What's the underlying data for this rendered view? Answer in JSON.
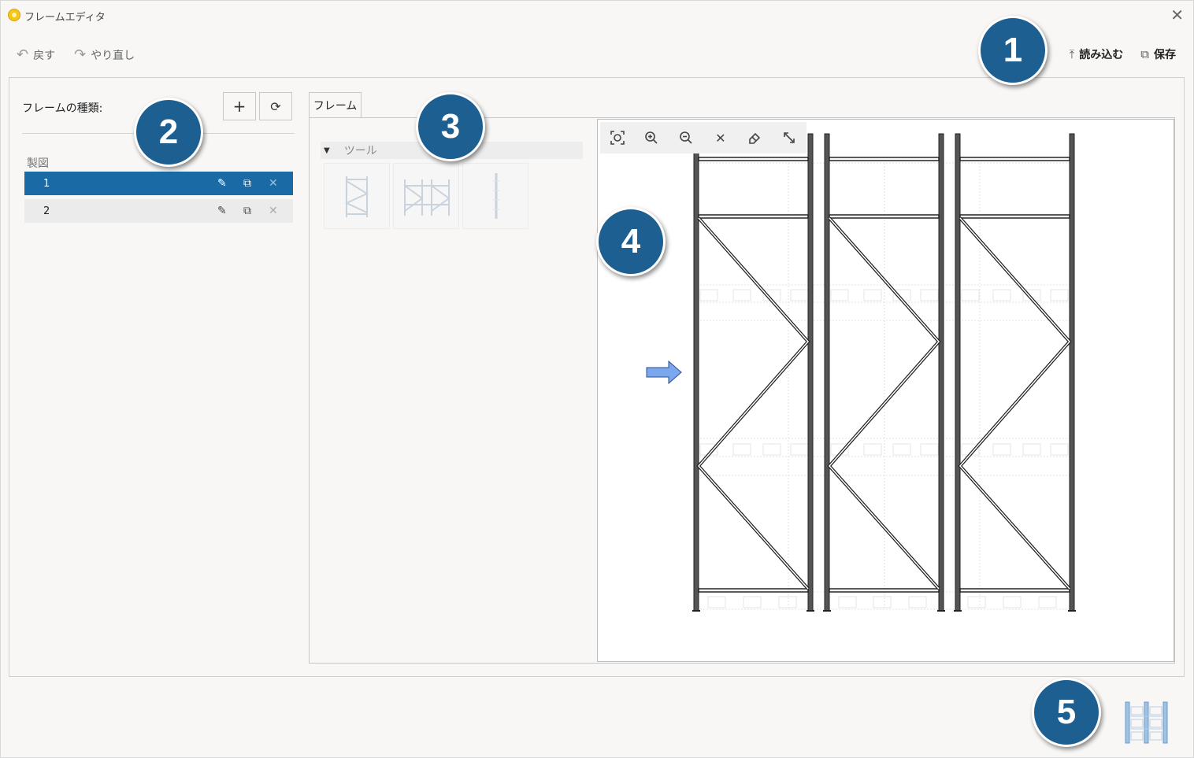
{
  "window": {
    "title": "フレームエディタ",
    "accent_color": "#1a6aa6",
    "callout_color": "#1e5f91"
  },
  "toolbar": {
    "undo_label": "戻す",
    "redo_label": "やり直し",
    "load_label": "読み込む",
    "save_label": "保存"
  },
  "left_panel": {
    "header": "フレームの種類:",
    "group_label": "製図",
    "items": [
      {
        "label": "1",
        "selected": true
      },
      {
        "label": "2",
        "selected": false
      }
    ]
  },
  "tabs": [
    {
      "label": "フレーム"
    }
  ],
  "tools": {
    "header": "ツール"
  },
  "callouts": [
    "1",
    "2",
    "3",
    "4",
    "5"
  ],
  "icons": {
    "undo": "undo-icon",
    "redo": "redo-icon",
    "load": "upload-icon",
    "save": "copy-icon",
    "add": "plus-icon",
    "refresh": "refresh-icon",
    "edit": "pencil-icon",
    "duplicate": "duplicate-icon",
    "delete": "close-icon",
    "fit": "fit-view-icon",
    "zoom_in": "zoom-in-icon",
    "zoom_out": "zoom-out-icon",
    "clear": "close-icon",
    "eraser": "eraser-icon",
    "resize": "resize-icon"
  }
}
